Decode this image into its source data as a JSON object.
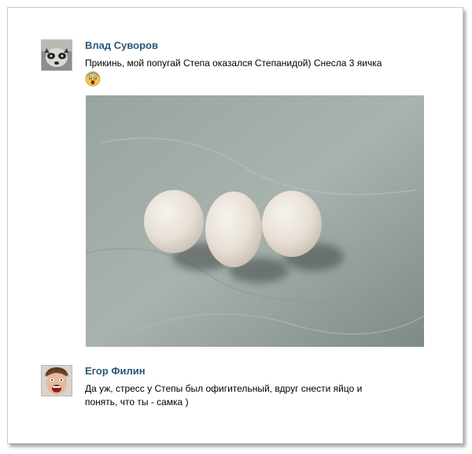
{
  "post1": {
    "author": "Влад Суворов",
    "text": "Прикинь, мой попугай Степа оказался Степанидой) Снесла 3 яичка",
    "emoji_icon": "fearful-face-emoji",
    "photo_icon": "three-eggs-photo"
  },
  "post2": {
    "author": "Егор Филин",
    "text_line1": "Да уж, стресс у Степы был офигительный, вдруг снести яйцо и",
    "text_line2": "понять, что ты - самка )"
  },
  "colors": {
    "author_link": "#2b587a",
    "frame_border": "#c9c9c9"
  }
}
